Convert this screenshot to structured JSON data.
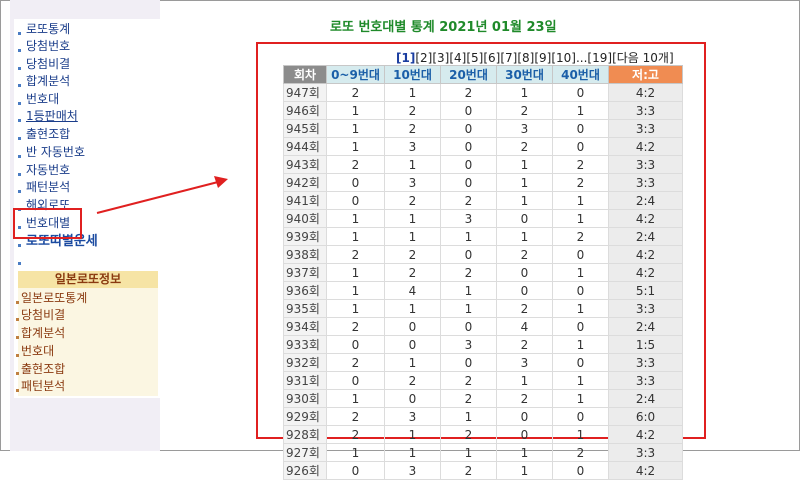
{
  "sidebar": {
    "items": [
      {
        "label": "로또통계",
        "style": ""
      },
      {
        "label": "당첨번호",
        "style": ""
      },
      {
        "label": "당첨비결",
        "style": ""
      },
      {
        "label": "합계분석",
        "style": ""
      },
      {
        "label": "번호대",
        "style": ""
      },
      {
        "label": "1등판매처",
        "style": "u"
      },
      {
        "label": "출현조합",
        "style": ""
      },
      {
        "label": "반 자동번호",
        "style": ""
      },
      {
        "label": "자동번호",
        "style": ""
      },
      {
        "label": "패턴분석",
        "style": ""
      },
      {
        "label": "해외로또",
        "style": ""
      },
      {
        "label": "번호대별",
        "style": ""
      },
      {
        "label": "로또띠별운세",
        "style": "bold"
      },
      {
        "label": "",
        "style": ""
      }
    ],
    "japan_header": "일본로또정보",
    "japan_items": [
      "일본로또통계",
      "당첨비결",
      "합계분석",
      "번호대",
      "출현조합",
      "패턴분석"
    ]
  },
  "page": {
    "title": "로또 번호대별 통계 2021년 01월 23일"
  },
  "pager": {
    "pages": [
      "[1]",
      "[2]",
      "[3]",
      "[4]",
      "[5]",
      "[6]",
      "[7]",
      "[8]",
      "[9]",
      "[10]",
      "...",
      "[19]",
      "[다음 10개]"
    ],
    "current": "[1]"
  },
  "table": {
    "headers": [
      "회차",
      "0~9번대",
      "10번대",
      "20번대",
      "30번대",
      "40번대",
      "저:고"
    ],
    "rows": [
      [
        "947회",
        "2",
        "1",
        "2",
        "1",
        "0",
        "4:2"
      ],
      [
        "946회",
        "1",
        "2",
        "0",
        "2",
        "1",
        "3:3"
      ],
      [
        "945회",
        "1",
        "2",
        "0",
        "3",
        "0",
        "3:3"
      ],
      [
        "944회",
        "1",
        "3",
        "0",
        "2",
        "0",
        "4:2"
      ],
      [
        "943회",
        "2",
        "1",
        "0",
        "1",
        "2",
        "3:3"
      ],
      [
        "942회",
        "0",
        "3",
        "0",
        "1",
        "2",
        "3:3"
      ],
      [
        "941회",
        "0",
        "2",
        "2",
        "1",
        "1",
        "2:4"
      ],
      [
        "940회",
        "1",
        "1",
        "3",
        "0",
        "1",
        "4:2"
      ],
      [
        "939회",
        "1",
        "1",
        "1",
        "1",
        "2",
        "2:4"
      ],
      [
        "938회",
        "2",
        "2",
        "0",
        "2",
        "0",
        "4:2"
      ],
      [
        "937회",
        "1",
        "2",
        "2",
        "0",
        "1",
        "4:2"
      ],
      [
        "936회",
        "1",
        "4",
        "1",
        "0",
        "0",
        "5:1"
      ],
      [
        "935회",
        "1",
        "1",
        "1",
        "2",
        "1",
        "3:3"
      ],
      [
        "934회",
        "2",
        "0",
        "0",
        "4",
        "0",
        "2:4"
      ],
      [
        "933회",
        "0",
        "0",
        "3",
        "2",
        "1",
        "1:5"
      ],
      [
        "932회",
        "2",
        "1",
        "0",
        "3",
        "0",
        "3:3"
      ],
      [
        "931회",
        "0",
        "2",
        "2",
        "1",
        "1",
        "3:3"
      ],
      [
        "930회",
        "1",
        "0",
        "2",
        "2",
        "1",
        "2:4"
      ],
      [
        "929회",
        "2",
        "3",
        "1",
        "0",
        "0",
        "6:0"
      ],
      [
        "928회",
        "2",
        "1",
        "2",
        "0",
        "1",
        "4:2"
      ],
      [
        "927회",
        "1",
        "1",
        "1",
        "1",
        "2",
        "3:3"
      ],
      [
        "926회",
        "0",
        "3",
        "2",
        "1",
        "0",
        "4:2"
      ]
    ]
  },
  "colors": {
    "title_green": "#1f8a2a",
    "highlight_red": "#e02020",
    "ratio_header": "#f08c52",
    "decade_header": "#d6ebee"
  },
  "icons": [
    "bullet-icon",
    "arrow-annotation"
  ]
}
